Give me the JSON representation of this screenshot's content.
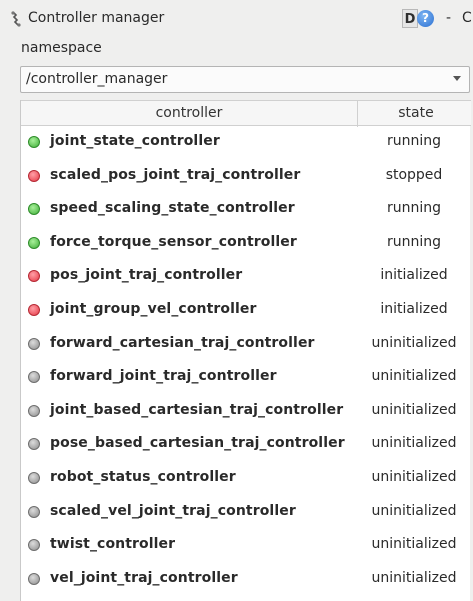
{
  "window": {
    "title": "Controller manager",
    "d_button_label": "D",
    "help_label": "?",
    "dash_label": "-",
    "cut_label": "C"
  },
  "namespace": {
    "label": "namespace",
    "selected": "/controller_manager"
  },
  "table": {
    "columns": [
      "controller",
      "state"
    ],
    "rows": [
      {
        "name": "joint_state_controller",
        "state": "running",
        "led": "green"
      },
      {
        "name": "scaled_pos_joint_traj_controller",
        "state": "stopped",
        "led": "red"
      },
      {
        "name": "speed_scaling_state_controller",
        "state": "running",
        "led": "green"
      },
      {
        "name": "force_torque_sensor_controller",
        "state": "running",
        "led": "green"
      },
      {
        "name": "pos_joint_traj_controller",
        "state": "initialized",
        "led": "red"
      },
      {
        "name": "joint_group_vel_controller",
        "state": "initialized",
        "led": "red"
      },
      {
        "name": "forward_cartesian_traj_controller",
        "state": "uninitialized",
        "led": "gray"
      },
      {
        "name": "forward_joint_traj_controller",
        "state": "uninitialized",
        "led": "gray"
      },
      {
        "name": "joint_based_cartesian_traj_controller",
        "state": "uninitialized",
        "led": "gray"
      },
      {
        "name": "pose_based_cartesian_traj_controller",
        "state": "uninitialized",
        "led": "gray"
      },
      {
        "name": "robot_status_controller",
        "state": "uninitialized",
        "led": "gray"
      },
      {
        "name": "scaled_vel_joint_traj_controller",
        "state": "uninitialized",
        "led": "gray"
      },
      {
        "name": "twist_controller",
        "state": "uninitialized",
        "led": "gray"
      },
      {
        "name": "vel_joint_traj_controller",
        "state": "uninitialized",
        "led": "gray"
      }
    ]
  },
  "colors": {
    "running_led": "#3fae38",
    "stopped_led": "#e63946",
    "uninitialized_led": "#8c8c8c"
  }
}
